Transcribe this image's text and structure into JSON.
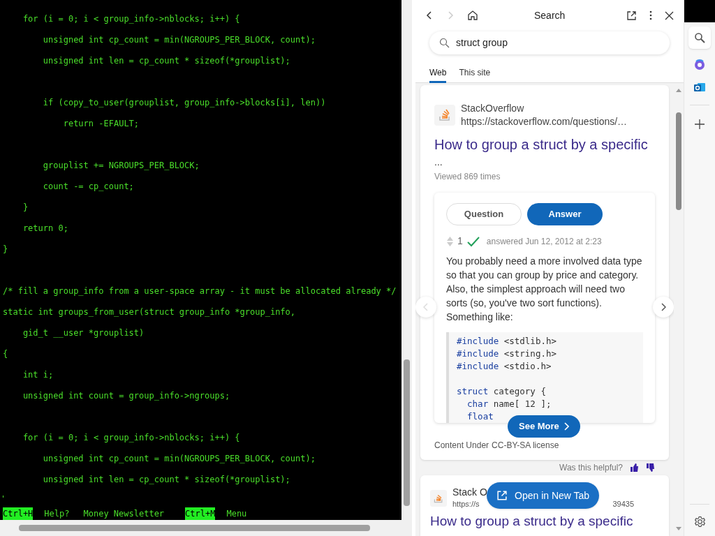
{
  "terminal": {
    "lines": [
      {
        "text": "    for (i = 0; i < group_info->nblocks; i++) {",
        "gap_before": false
      },
      {
        "text": "        unsigned int cp_count = min(NGROUPS_PER_BLOCK, count);",
        "gap_before": false
      },
      {
        "text": "        unsigned int len = cp_count * sizeof(*grouplist);",
        "gap_before": false
      },
      {
        "text": "        if (copy_to_user(grouplist, group_info->blocks[i], len))",
        "gap_before": true
      },
      {
        "text": "            return -EFAULT;",
        "gap_before": false
      },
      {
        "text": "        grouplist += NGROUPS_PER_BLOCK;",
        "gap_before": true
      },
      {
        "text": "        count -= cp_count;",
        "gap_before": false
      },
      {
        "text": "    }",
        "gap_before": false
      },
      {
        "text": "    return 0;",
        "gap_before": false
      },
      {
        "text": "}",
        "gap_before": false
      },
      {
        "text": "/* fill a group_info from a user-space array - it must be allocated already */",
        "gap_before": true
      },
      {
        "text": "static int groups_from_user(struct group_info *group_info,",
        "gap_before": false
      },
      {
        "text": "    gid_t __user *grouplist)",
        "gap_before": false
      },
      {
        "text": "{",
        "gap_before": false
      },
      {
        "text": "    int i;",
        "gap_before": false
      },
      {
        "text": "    unsigned int count = group_info->ngroups;",
        "gap_before": false
      },
      {
        "text": "    for (i = 0; i < group_info->nblocks; i++) {",
        "gap_before": true
      },
      {
        "text": "        unsigned int cp_count = min(NGROUPS_PER_BLOCK, count);",
        "gap_before": false
      },
      {
        "text": "        unsigned int len = cp_count * sizeof(*grouplist);",
        "gap_before": false
      }
    ],
    "status_bar": [
      {
        "kind": "key",
        "text": "Ctrl+H"
      },
      {
        "kind": "label",
        "text": "Help?"
      },
      {
        "kind": "label",
        "text": "Money Newsletter"
      },
      {
        "kind": "key",
        "text": "Ctrl+M"
      },
      {
        "kind": "label",
        "text": "Menu"
      }
    ]
  },
  "search_panel": {
    "title": "Search",
    "search": {
      "value": "struct group"
    },
    "tabs": [
      {
        "label": "Web",
        "selected": true
      },
      {
        "label": "This site",
        "selected": false
      }
    ],
    "result": {
      "source": "StackOverflow",
      "url": "https://stackoverflow.com/questions/…",
      "title": "How to group a struct by a specific",
      "title_cont": "...",
      "views": "Viewed 869 times",
      "toggle": [
        {
          "label": "Question",
          "selected": false
        },
        {
          "label": "Answer",
          "selected": true
        }
      ],
      "votes": "1",
      "accepted": true,
      "answered": "answered Jun 12, 2012 at 2:23",
      "answer": "You probably need a more involved data type so that you can group by price and category. Also, the simplest approach will need two sorts (so, you've two sort functions). Something like:",
      "code": [
        {
          "keyword": "#include",
          "rest": " <stdlib.h>",
          "gap_before": false
        },
        {
          "keyword": "#include",
          "rest": " <string.h>",
          "gap_before": false
        },
        {
          "keyword": "#include",
          "rest": " <stdio.h>",
          "gap_before": false
        },
        {
          "keyword": "struct",
          "rest": " category {",
          "gap_before": true
        },
        {
          "keyword": "  char",
          "rest": " name[ 12 ];",
          "gap_before": false
        },
        {
          "keyword": "  float",
          "gap_before": false
        }
      ],
      "see_more": "See More",
      "license_prefix": "Content Under",
      "license_link": "CC-BY-SA license"
    },
    "feedback": "Was this helpful?",
    "result2": {
      "source": "Stack O",
      "url_start": "https://s",
      "url_end": "39435",
      "title": "How to group a struct by a specific"
    },
    "open_button": "Open in New Tab"
  }
}
